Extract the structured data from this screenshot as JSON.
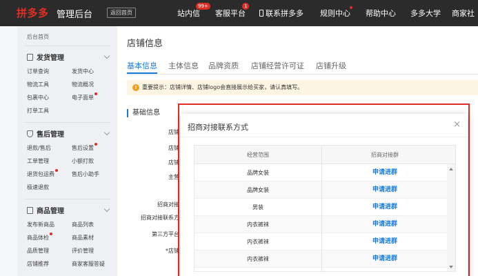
{
  "topbar": {
    "logo": "拼多多",
    "logo_sub": "管理后台",
    "back_home": "返回首页",
    "nav": [
      {
        "label": "站内信",
        "badge": "99+"
      },
      {
        "label": "客服平台",
        "badge": "1"
      },
      {
        "label": "联系拼多多"
      },
      {
        "label": "规则中心"
      },
      {
        "label": "帮助中心"
      },
      {
        "label": "多多大学"
      },
      {
        "label": "商家社"
      }
    ]
  },
  "sidebar": {
    "home": "后台首页",
    "sections": [
      {
        "title": "发货管理",
        "icon": "document-icon",
        "links": [
          "订单查询",
          "发货中心",
          "物流工具",
          "物流概况",
          "包裹中心",
          "电子面单",
          "打单工具"
        ]
      },
      {
        "title": "售后管理",
        "icon": "shield-icon",
        "links": [
          "退款/售后",
          "售后设置",
          "工单管理",
          "小额打款",
          "退货包运费",
          "售后小助手",
          "极速退款"
        ]
      },
      {
        "title": "商品管理",
        "icon": "goods-icon",
        "links": [
          "发布新商品",
          "商品列表",
          "商品体检",
          "商品素材",
          "品质管理",
          "评价管理",
          "店铺推荐",
          "商家客服答疑"
        ]
      }
    ]
  },
  "main": {
    "title": "店铺信息",
    "tabs": [
      "基本信息",
      "主体信息",
      "品牌资质",
      "店铺经营许可证",
      "店铺升级"
    ],
    "notice": "重要提示：店铺详情、店铺logo会直接展示给买家，请认真填写。",
    "section_title": "基础信息",
    "fields": [
      "店铺",
      "店铺",
      "店铺",
      "主营",
      "招商对接",
      "招商对接联系方",
      "第三方平台",
      "*店铺"
    ]
  },
  "modal": {
    "title": "招商对接联系方式",
    "close": "×",
    "headers": [
      "经营范围",
      "招商对接群"
    ],
    "rows": [
      {
        "scope": "品牌女装",
        "action": "申请进群"
      },
      {
        "scope": "品牌女装",
        "action": "申请进群"
      },
      {
        "scope": "男装",
        "action": "申请进群"
      },
      {
        "scope": "内衣裤袜",
        "action": "申请进群"
      },
      {
        "scope": "内衣裤袜",
        "action": "申请进群"
      },
      {
        "scope": "内衣裤袜",
        "action": "申请进群"
      }
    ]
  },
  "colors": {
    "accent": "#1a7ad9",
    "brand": "#e02e24",
    "topbar": "#2b2b2b"
  }
}
